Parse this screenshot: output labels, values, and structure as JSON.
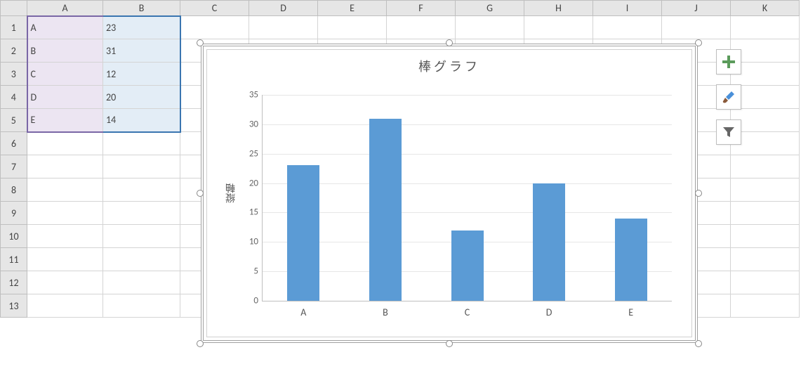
{
  "columns": [
    "A",
    "B",
    "C",
    "D",
    "E",
    "F",
    "G",
    "H",
    "I",
    "J",
    "K"
  ],
  "rows": [
    1,
    2,
    3,
    4,
    5,
    6,
    7,
    8,
    9,
    10,
    11,
    12,
    13
  ],
  "cells": {
    "A1": "A",
    "B1": "23",
    "A2": "B",
    "B2": "31",
    "A3": "C",
    "B3": "12",
    "A4": "D",
    "B4": "20",
    "A5": "E",
    "B5": "14"
  },
  "chart_title": "棒グラフ",
  "y_axis_label": "縦軸",
  "y_ticks": [
    "0",
    "5",
    "10",
    "15",
    "20",
    "25",
    "30",
    "35"
  ],
  "cat_labels": [
    "A",
    "B",
    "C",
    "D",
    "E"
  ],
  "chart_data": {
    "type": "bar",
    "title": "棒グラフ",
    "categories": [
      "A",
      "B",
      "C",
      "D",
      "E"
    ],
    "values": [
      23,
      31,
      12,
      20,
      14
    ],
    "xlabel": "",
    "ylabel": "縦軸",
    "ylim": [
      0,
      35
    ],
    "ytick_interval": 5
  }
}
